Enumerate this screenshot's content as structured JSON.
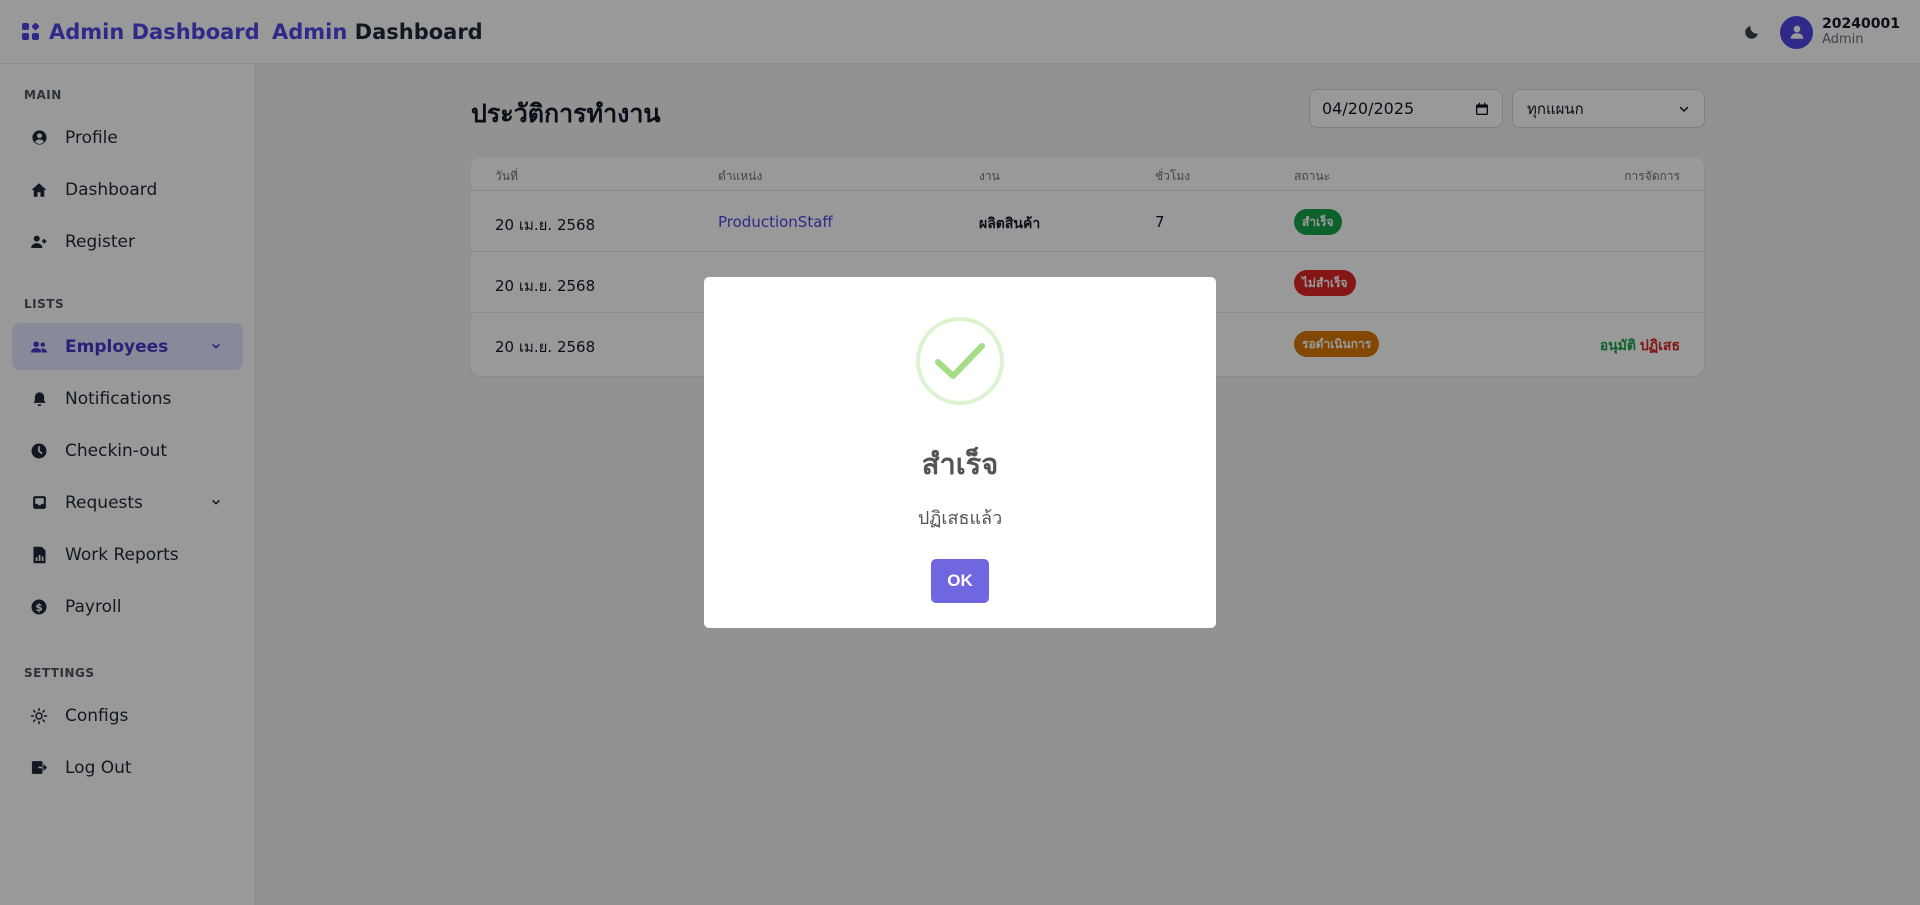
{
  "header": {
    "brand_title": "Admin Dashboard",
    "page_title_accent": "Admin",
    "page_title_rest": "Dashboard",
    "user_id": "20240001",
    "user_role": "Admin"
  },
  "sidebar": {
    "sections": [
      {
        "label": "MAIN",
        "items": [
          {
            "label": "Profile",
            "icon": "user-circle-icon"
          },
          {
            "label": "Dashboard",
            "icon": "home-icon"
          },
          {
            "label": "Register",
            "icon": "user-plus-icon"
          }
        ]
      },
      {
        "label": "LISTS",
        "items": [
          {
            "label": "Employees",
            "icon": "users-icon",
            "active": true,
            "expandable": true
          },
          {
            "label": "Notifications",
            "icon": "bell-icon"
          },
          {
            "label": "Checkin-out",
            "icon": "clock-icon"
          },
          {
            "label": "Requests",
            "icon": "inbox-icon",
            "expandable": true
          },
          {
            "label": "Work Reports",
            "icon": "report-icon"
          },
          {
            "label": "Payroll",
            "icon": "dollar-icon"
          }
        ]
      },
      {
        "label": "SETTINGS",
        "items": [
          {
            "label": "Configs",
            "icon": "sun-gear-icon"
          },
          {
            "label": "Log Out",
            "icon": "logout-icon"
          }
        ]
      }
    ]
  },
  "content": {
    "title": "ประวัติการทำงาน",
    "date_value": "04/20/2025",
    "department_select": "ทุกแผนก",
    "table": {
      "headers": [
        "วันที่",
        "ตำแหน่ง",
        "งาน",
        "ชั่วโมง",
        "สถานะ",
        "การจัดการ"
      ],
      "rows": [
        {
          "date": "20 เม.ย. 2568",
          "position": "ProductionStaff",
          "task": "ผลิตสินค้า",
          "hours": "7",
          "status": "สำเร็จ",
          "status_color": "#16a34a"
        },
        {
          "date": "20 เม.ย. 2568",
          "position": "",
          "task": "",
          "hours": "",
          "status": "ไม่สำเร็จ",
          "status_color": "#dc2626"
        },
        {
          "date": "20 เม.ย. 2568",
          "position": "",
          "task": "",
          "hours": "",
          "status": "รอดำเนินการ",
          "status_color": "#d97706",
          "approve": "อนุมัติ",
          "reject": "ปฏิเสธ"
        }
      ]
    }
  },
  "modal": {
    "title": "สำเร็จ",
    "text": "ปฏิเสธแล้ว",
    "ok_label": "OK",
    "accent_color": "#7066e0",
    "check_color": "#a5dc86"
  }
}
